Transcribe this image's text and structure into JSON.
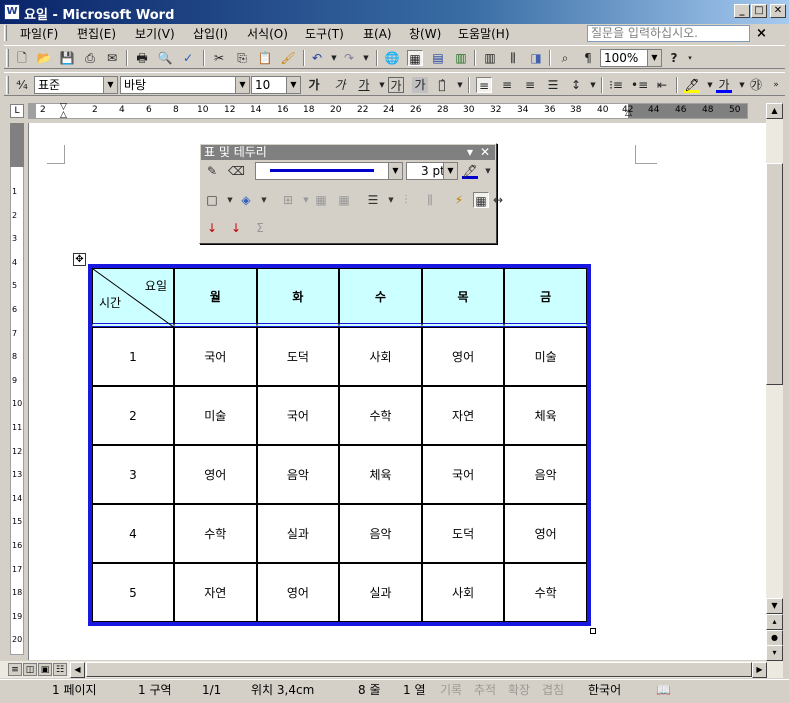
{
  "window": {
    "title": "요일 - Microsoft Word",
    "icon_label": "W",
    "controls": {
      "minimize": "_",
      "maximize": "□",
      "close": "✕"
    }
  },
  "menu": {
    "items": [
      "파일(F)",
      "편집(E)",
      "보기(V)",
      "삽입(I)",
      "서식(O)",
      "도구(T)",
      "표(A)",
      "창(W)",
      "도움말(H)"
    ],
    "help_placeholder": "질문을 입력하십시오.",
    "doc_close": "×"
  },
  "toolbar": {
    "zoom": "100%",
    "help_btn": "?"
  },
  "format_bar": {
    "style": "표준",
    "font": "바탕",
    "size": "10",
    "bold": "가",
    "italic": "가",
    "underline": "가",
    "char_border": "가",
    "char_shading": "가"
  },
  "ruler": {
    "h_numbers": [
      "2",
      "2",
      "4",
      "6",
      "8",
      "10",
      "12",
      "14",
      "16",
      "18",
      "20",
      "22",
      "24",
      "26",
      "28",
      "30",
      "32",
      "34",
      "36",
      "38",
      "40",
      "42",
      "44",
      "46",
      "48",
      "50"
    ],
    "v_numbers": [
      "1",
      "2",
      "3",
      "4",
      "5",
      "6",
      "7",
      "8",
      "9",
      "10",
      "11",
      "12",
      "13",
      "14",
      "15",
      "16",
      "17",
      "18",
      "19",
      "20"
    ]
  },
  "palette": {
    "title": "표 및 테두리",
    "line_weight": "3 pt",
    "sum_icon": "Σ",
    "accent": "#0000cc"
  },
  "table": {
    "header": {
      "diagonal_top": "요일",
      "diagonal_bottom": "시간",
      "days": [
        "월",
        "화",
        "수",
        "목",
        "금"
      ]
    },
    "rows": [
      {
        "period": "1",
        "subjects": [
          "국어",
          "도덕",
          "사회",
          "영어",
          "미술"
        ]
      },
      {
        "period": "2",
        "subjects": [
          "미술",
          "국어",
          "수학",
          "자연",
          "체육"
        ]
      },
      {
        "period": "3",
        "subjects": [
          "영어",
          "음악",
          "체육",
          "국어",
          "음악"
        ]
      },
      {
        "period": "4",
        "subjects": [
          "수학",
          "실과",
          "음악",
          "도덕",
          "영어"
        ]
      },
      {
        "period": "5",
        "subjects": [
          "자연",
          "영어",
          "실과",
          "사회",
          "수학"
        ]
      }
    ],
    "border_color": "#1818e0",
    "header_bg": "#ccffff"
  },
  "status": {
    "page": "1 페이지",
    "section": "1 구역",
    "page_of": "1/1",
    "position": "위치 3,4cm",
    "line": "8 줄",
    "column": "1 열",
    "rec": "기록",
    "trk": "추적",
    "ext": "확장",
    "ovr": "겹침",
    "language": "한국어"
  }
}
